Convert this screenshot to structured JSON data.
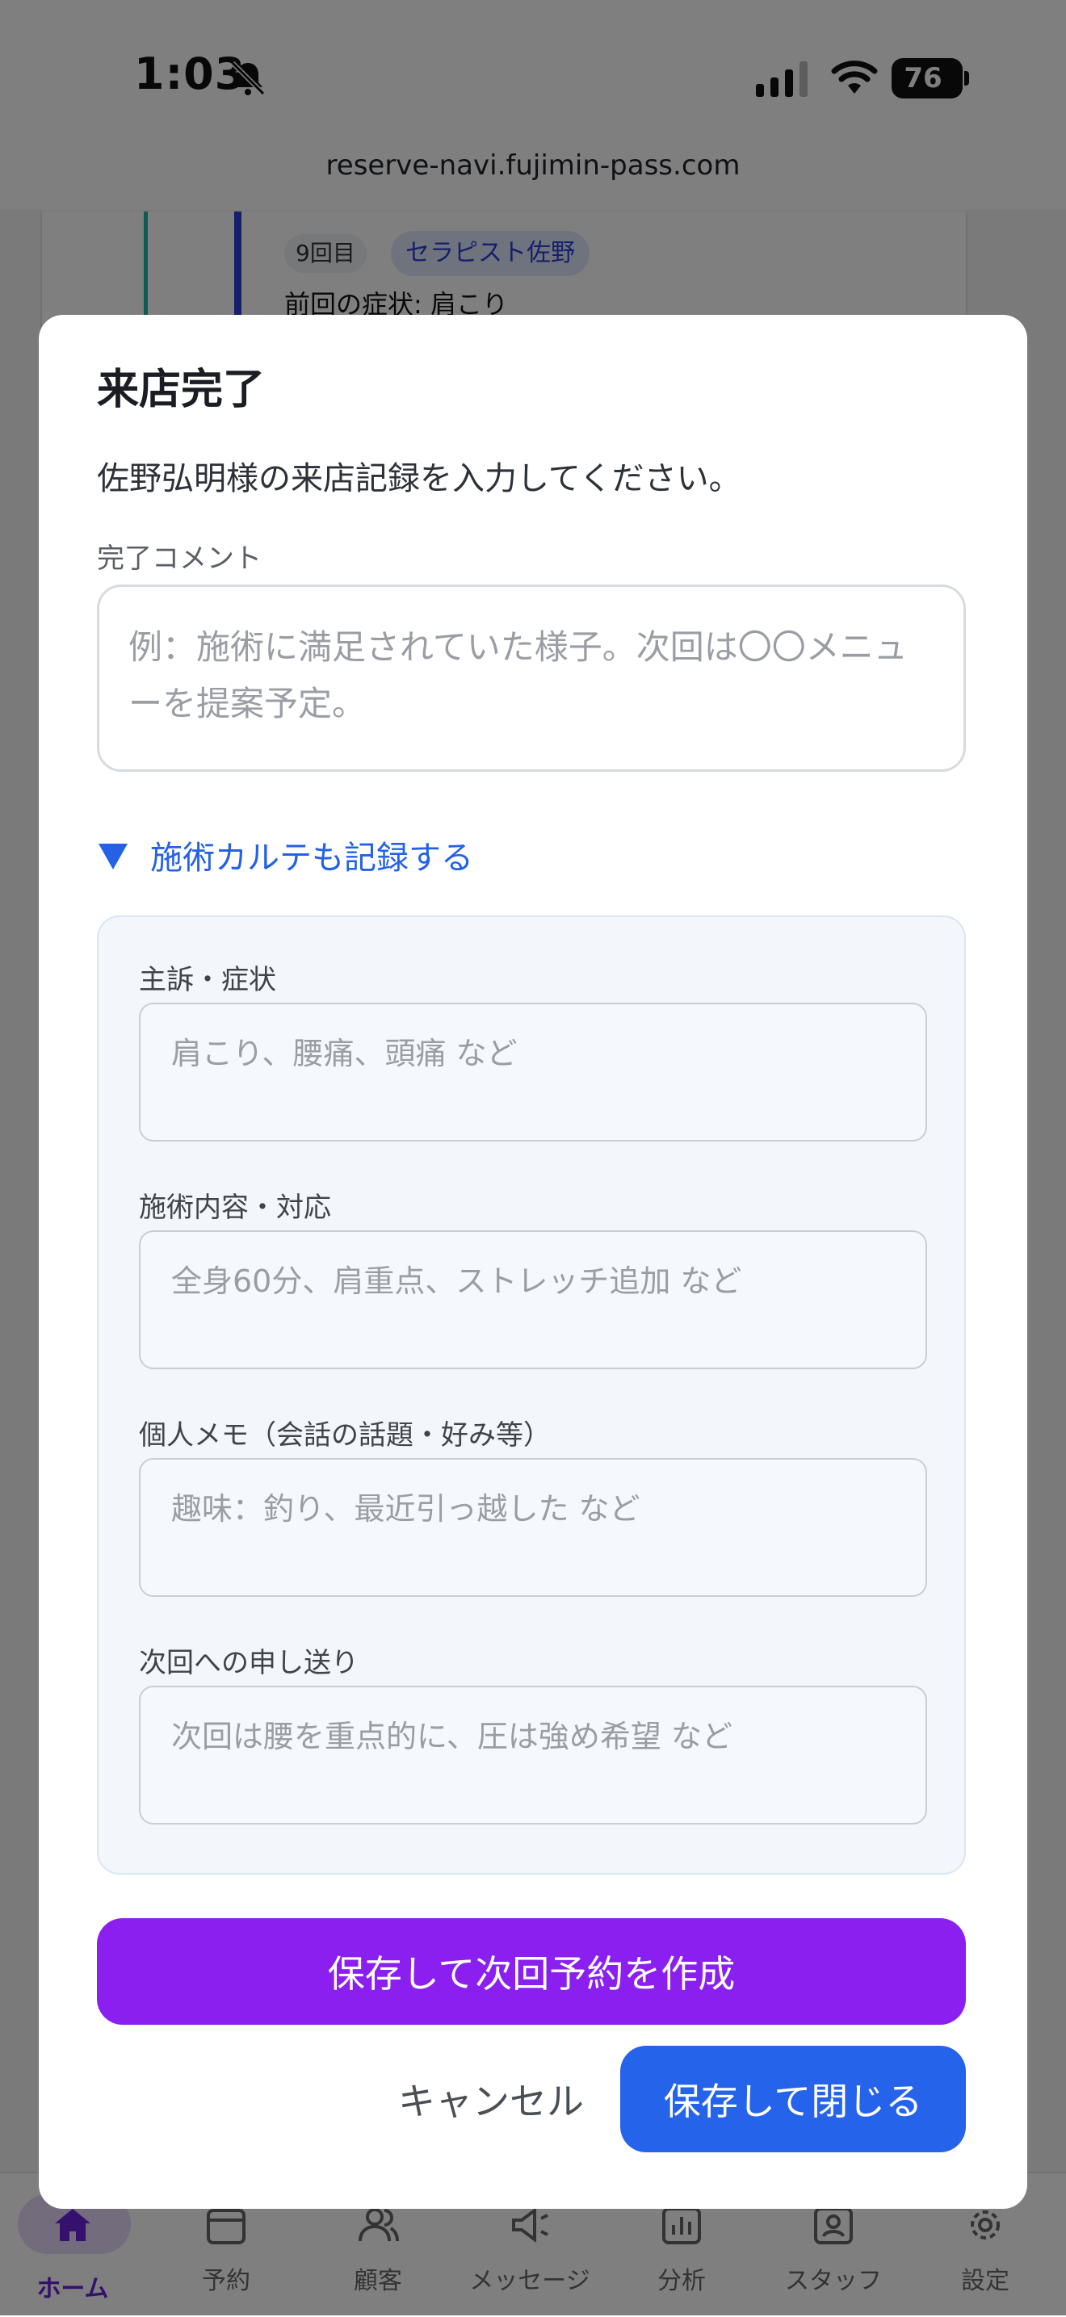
{
  "status_bar": {
    "time": "1:03",
    "battery": "76"
  },
  "browser": {
    "url": "reserve-navi.fujimin-pass.com"
  },
  "background_card": {
    "visit_count": "9回目",
    "staff_badge": "セラピスト佐野",
    "previous_symptom": "前回の症状: 肩こり"
  },
  "tabs": [
    {
      "label": "ホーム",
      "icon": "home-icon",
      "active": true
    },
    {
      "label": "予約",
      "icon": "calendar-icon"
    },
    {
      "label": "顧客",
      "icon": "users-icon"
    },
    {
      "label": "メッセージ",
      "icon": "megaphone-icon"
    },
    {
      "label": "分析",
      "icon": "chart-icon"
    },
    {
      "label": "スタッフ",
      "icon": "staff-badge-icon"
    },
    {
      "label": "設定",
      "icon": "gear-icon"
    }
  ],
  "modal": {
    "title": "来店完了",
    "description": "佐野弘明様の来店記録を入力してください。",
    "comment": {
      "label": "完了コメント",
      "value": "",
      "placeholder": "例：施術に満足されていた様子。次回は〇〇メニューを提案予定。"
    },
    "karte_toggle": {
      "label": "施術カルテも記録する",
      "icon": "triangle-down-icon"
    },
    "karte_fields": [
      {
        "label": "主訴・症状",
        "value": "",
        "placeholder": "肩こり、腰痛、頭痛 など"
      },
      {
        "label": "施術内容・対応",
        "value": "",
        "placeholder": "全身60分、肩重点、ストレッチ追加 など"
      },
      {
        "label": "個人メモ（会話の話題・好み等）",
        "value": "",
        "placeholder": "趣味：釣り、最近引っ越した など"
      },
      {
        "label": "次回への申し送り",
        "value": "",
        "placeholder": "次回は腰を重点的に、圧は強め希望 など"
      }
    ],
    "buttons": {
      "save_and_next": "保存して次回予約を作成",
      "cancel": "キャンセル",
      "save_and_close": "保存して閉じる"
    }
  },
  "colors": {
    "primary_purple": "#8a1ff0",
    "primary_blue": "#2563eb",
    "link_blue": "#2461e6",
    "active_tab": "#6b21d8"
  }
}
